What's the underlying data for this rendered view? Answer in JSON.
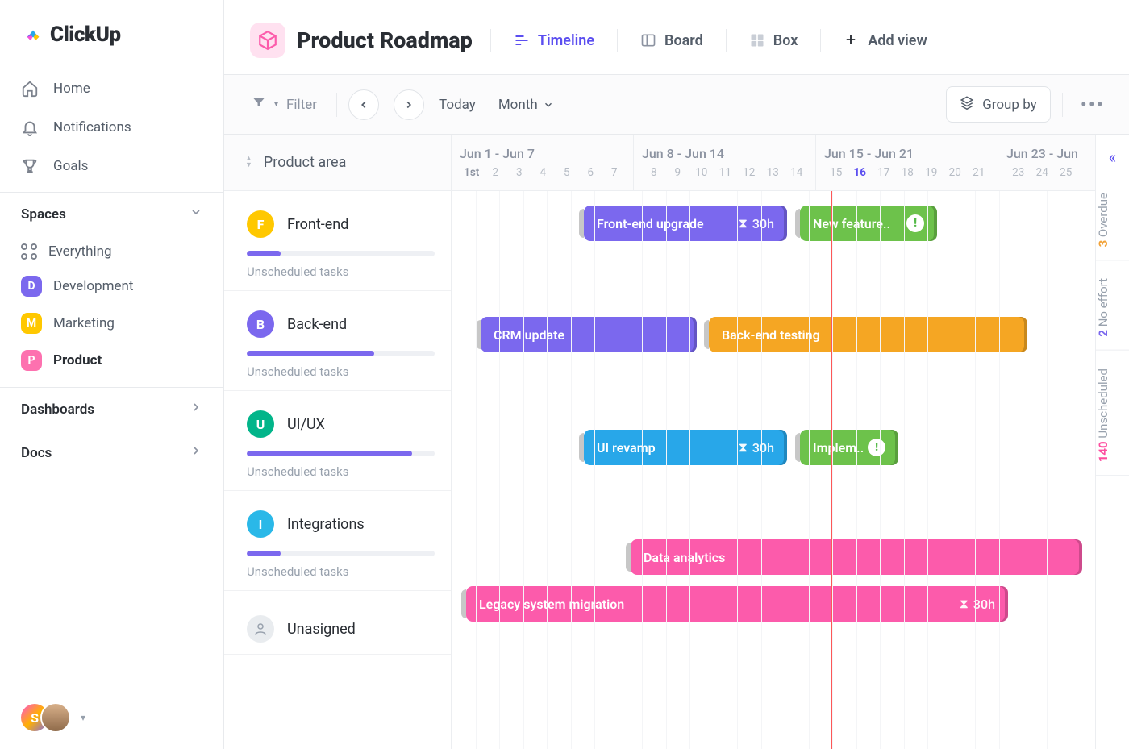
{
  "brand": "ClickUp",
  "nav": {
    "home": "Home",
    "notifications": "Notifications",
    "goals": "Goals"
  },
  "sections": {
    "spaces": "Spaces",
    "dashboards": "Dashboards",
    "docs": "Docs"
  },
  "everything_label": "Everything",
  "spaces": [
    {
      "letter": "D",
      "label": "Development",
      "color": "#7b68ee"
    },
    {
      "letter": "M",
      "label": "Marketing",
      "color": "#ffc800"
    },
    {
      "letter": "P",
      "label": "Product",
      "color": "#fd71af"
    }
  ],
  "user_initial": "S",
  "page": {
    "title": "Product Roadmap",
    "views": {
      "timeline": "Timeline",
      "board": "Board",
      "box": "Box",
      "add": "Add view"
    }
  },
  "toolbar": {
    "filter": "Filter",
    "today": "Today",
    "range": "Month",
    "groupby": "Group by"
  },
  "leftcol_header": "Product area",
  "unscheduled_label": "Unscheduled tasks",
  "weeks": [
    {
      "label": "Jun 1 - Jun 7",
      "days": [
        "1st",
        "2",
        "3",
        "4",
        "5",
        "6",
        "7"
      ]
    },
    {
      "label": "Jun 8 - Jun 14",
      "days": [
        "8",
        "9",
        "10",
        "11",
        "12",
        "13",
        "14"
      ]
    },
    {
      "label": "Jun 15 - Jun 21",
      "days": [
        "15",
        "16",
        "17",
        "18",
        "19",
        "20",
        "21"
      ]
    },
    {
      "label": "Jun 23 - Jun",
      "days": [
        "23",
        "24",
        "25"
      ]
    }
  ],
  "today_day": "16",
  "groups": [
    {
      "letter": "F",
      "name": "Front-end",
      "color": "#ffc800",
      "progress": 18
    },
    {
      "letter": "B",
      "name": "Back-end",
      "color": "#7b68ee",
      "progress": 68
    },
    {
      "letter": "U",
      "name": "UI/UX",
      "color": "#02b58a",
      "progress": 88
    },
    {
      "letter": "I",
      "name": "Integrations",
      "color": "#2ab8e8",
      "progress": 18
    }
  ],
  "unassigned_label": "Unasigned",
  "bars": {
    "fe_upgrade": {
      "label": "Front-end upgrade",
      "hours": "30h"
    },
    "new_feature": {
      "label": "New feature.."
    },
    "crm_update": {
      "label": "CRM update"
    },
    "be_testing": {
      "label": "Back-end testing"
    },
    "ui_revamp": {
      "label": "UI revamp",
      "hours": "30h"
    },
    "implement": {
      "label": "Implem.."
    },
    "data_an": {
      "label": "Data analytics"
    },
    "legacy": {
      "label": "Legacy system migration",
      "hours": "30h"
    }
  },
  "rail": {
    "overdue_n": "3",
    "overdue": "Overdue",
    "noeffort_n": "2",
    "noeffort": "No effort",
    "unsch_n": "140",
    "unsch": "Unscheduled"
  },
  "colors": {
    "purple": "#7b68ee",
    "green": "#6dc24b",
    "orange": "#f5a623",
    "blue": "#28a7e9",
    "pink": "#fc5bab"
  }
}
